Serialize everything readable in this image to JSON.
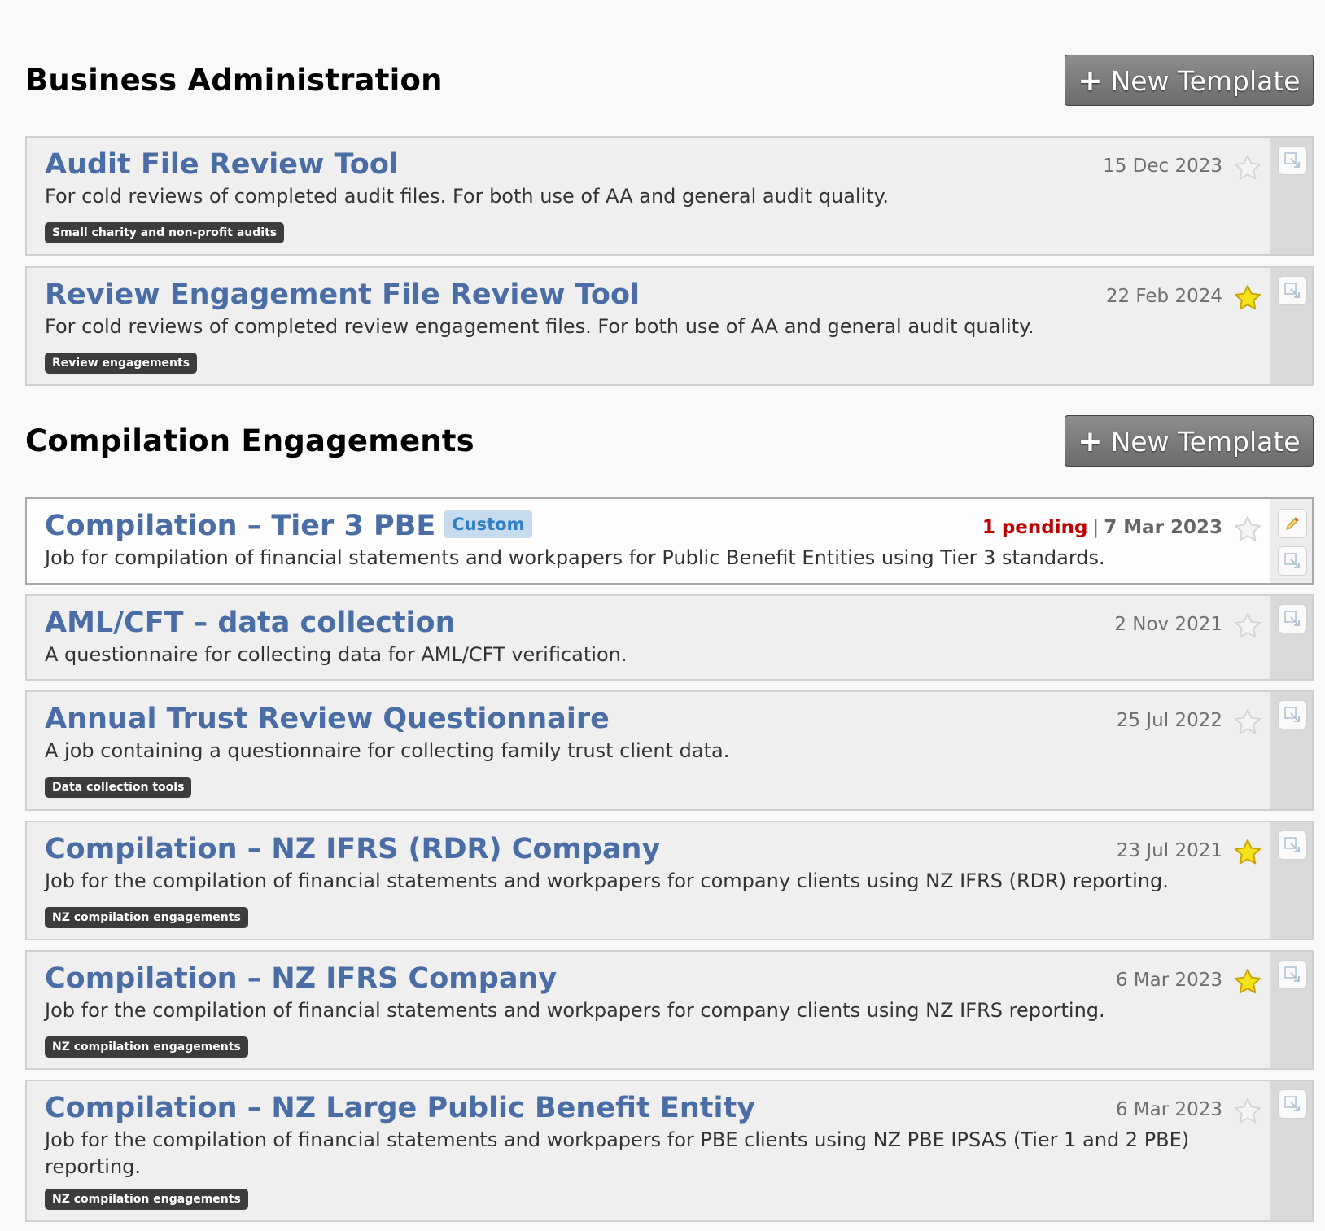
{
  "sections": [
    {
      "title": "Business Administration",
      "new_button": "New Template",
      "cards": [
        {
          "title": "Audit File Review Tool",
          "description": "For cold reviews of completed audit files. For both use of AA and general audit quality.",
          "tag": "Small charity and non-profit audits",
          "date": "15 Dec 2023",
          "starred": false
        },
        {
          "title": "Review Engagement File Review Tool",
          "description": "For cold reviews of completed review engagement files. For both use of AA and general audit quality.",
          "tag": "Review engagements",
          "date": "22 Feb 2024",
          "starred": true
        }
      ]
    },
    {
      "title": "Compilation Engagements",
      "new_button": "New Template",
      "cards": [
        {
          "title": "Compilation – Tier 3 PBE",
          "badge": "Custom",
          "description": "Job for compilation of financial statements and workpapers for Public Benefit Entities using Tier 3 standards.",
          "pending": "1 pending",
          "separator": "|",
          "date": "7 Mar 2023",
          "starred": false
        },
        {
          "title": "AML/CFT – data collection",
          "description": "A questionnaire for collecting data for AML/CFT verification.",
          "date": "2 Nov 2021",
          "starred": false
        },
        {
          "title": "Annual Trust Review Questionnaire",
          "description": "A job containing a questionnaire for collecting family trust client data.",
          "tag": "Data collection tools",
          "date": "25 Jul 2022",
          "starred": false
        },
        {
          "title": "Compilation – NZ IFRS (RDR) Company",
          "description": "Job for the compilation of financial statements and workpapers for company clients using NZ IFRS (RDR) reporting.",
          "tag": "NZ compilation engagements",
          "date": "23 Jul 2021",
          "starred": true
        },
        {
          "title": "Compilation – NZ IFRS Company",
          "description": "Job for the compilation of financial statements and workpapers for company clients using NZ IFRS reporting.",
          "tag": "NZ compilation engagements",
          "date": "6 Mar 2023",
          "starred": true
        },
        {
          "title": "Compilation – NZ Large Public Benefit Entity",
          "description": "Job for the compilation of financial statements and workpapers for PBE clients using NZ PBE IPSAS (Tier 1 and 2 PBE) reporting.",
          "tag": "NZ compilation engagements",
          "date": "6 Mar 2023",
          "starred": false
        }
      ]
    }
  ],
  "icons": {
    "star_empty": "star-outline-icon",
    "star_filled": "star-filled-icon",
    "open": "open-external-icon",
    "edit": "pencil-icon"
  },
  "colors": {
    "title_link": "#4a6da5",
    "pending": "#bf0000",
    "star_filled": "#f4e21c",
    "badge_bg": "#c6dbee",
    "badge_text": "#2f7fc4",
    "tag_bg": "#3a3c3e"
  }
}
